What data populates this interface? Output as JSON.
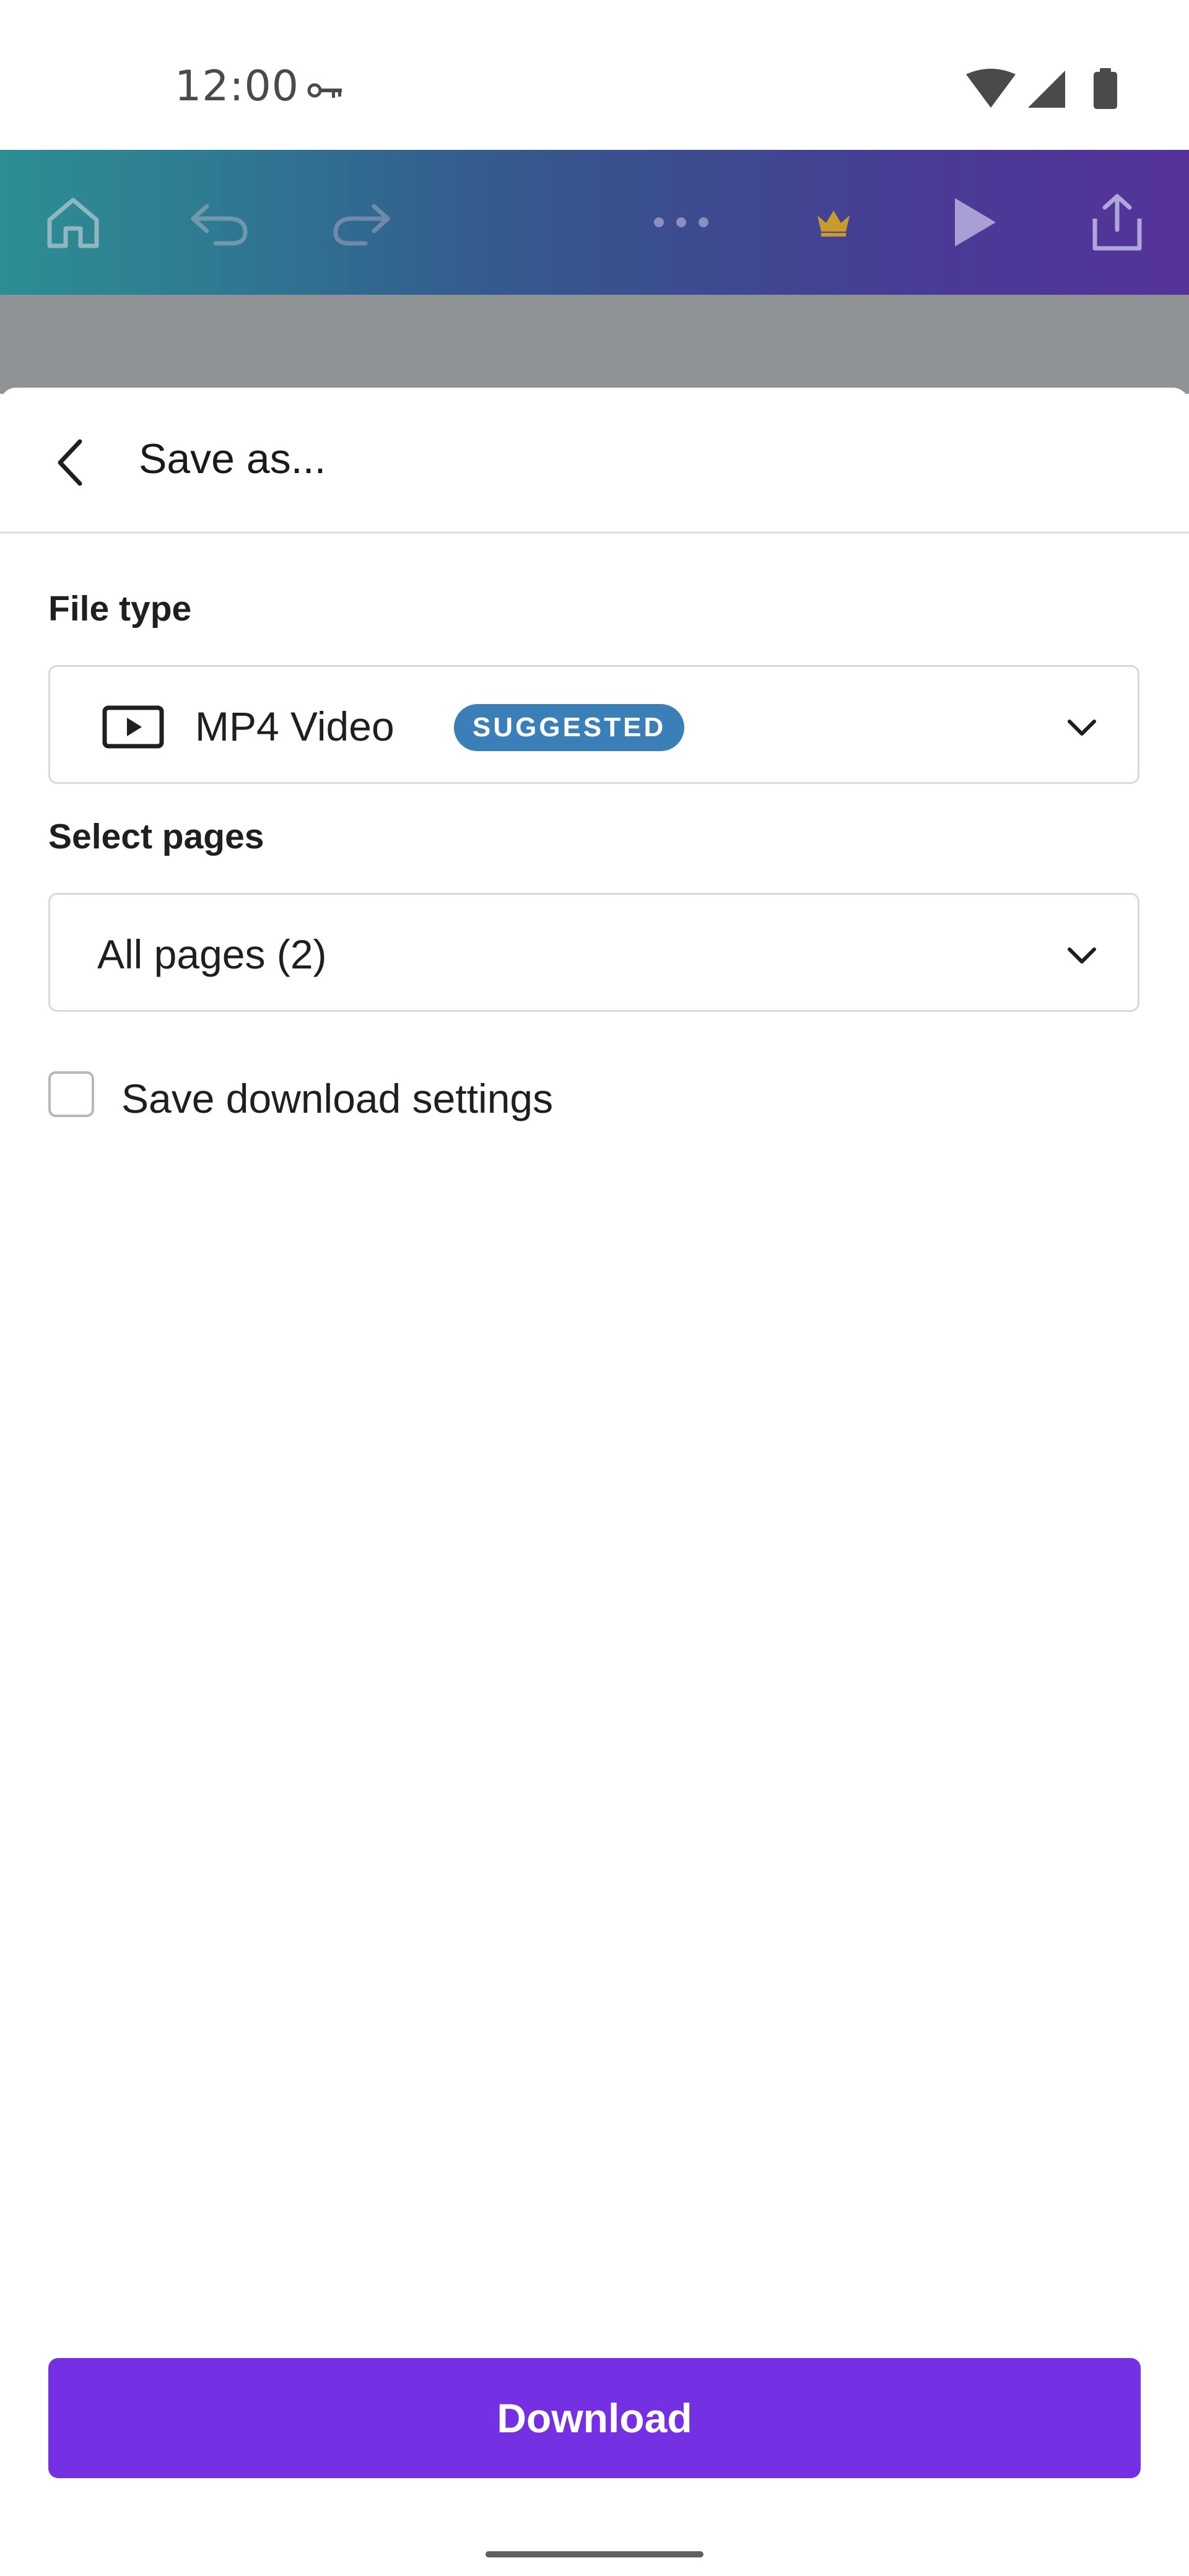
{
  "status_bar": {
    "time": "12:00",
    "icons": [
      "vpn-key-icon",
      "wifi-icon",
      "cellular-signal-icon",
      "battery-icon"
    ]
  },
  "toolbar": {
    "icons": [
      "home-icon",
      "undo-icon",
      "redo-icon",
      "more-icon",
      "crown-icon",
      "play-icon",
      "share-icon"
    ],
    "crown_color": "#c99a2e"
  },
  "sheet": {
    "title": "Save as...",
    "file_type": {
      "label": "File type",
      "value": "MP4 Video",
      "icon": "video-file-icon",
      "badge": "SUGGESTED"
    },
    "select_pages": {
      "label": "Select pages",
      "value": "All pages (2)"
    },
    "save_settings": {
      "label": "Save download settings",
      "checked": false
    },
    "download_label": "Download"
  },
  "colors": {
    "primary": "#7530e3",
    "badge": "#3b7fb8"
  }
}
